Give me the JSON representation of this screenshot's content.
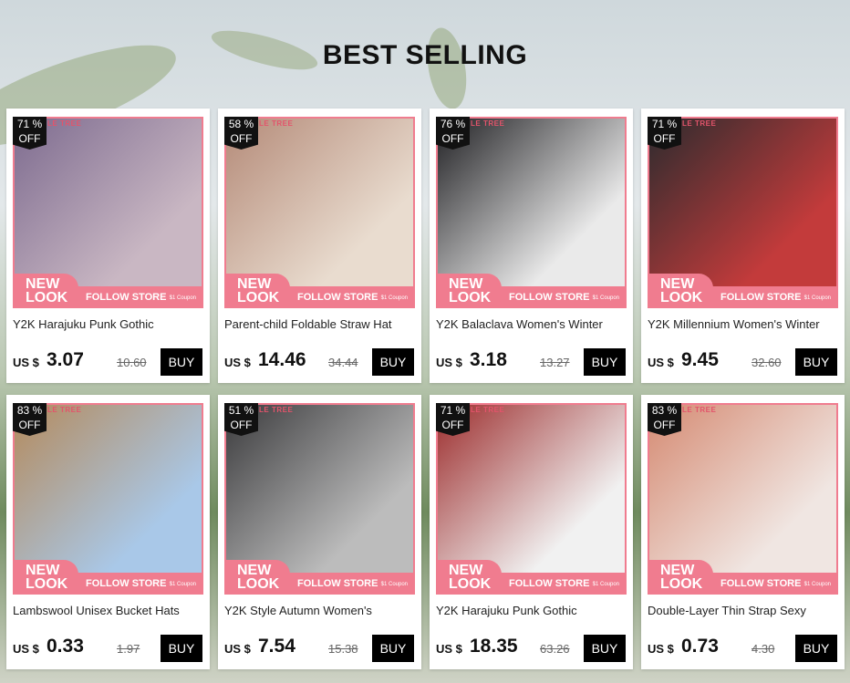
{
  "heading": "BEST SELLING",
  "store_tag": "LE TREE",
  "new_look": [
    "NEW",
    "LOOK"
  ],
  "follow_store": "FOLLOW STORE",
  "coupon": "$1 Coupon",
  "buy_label": "BUY",
  "off_label": "OFF",
  "currency": "US $",
  "colors": {
    "accent": "#f07c8f",
    "buy_bg": "#000000"
  },
  "products": [
    {
      "discount": "71 %",
      "title": "Y2K Harajuku Punk Gothic",
      "price": "3.07",
      "original": "10.60",
      "photo_colors": [
        "#7d6b8f",
        "#c9b7c3"
      ]
    },
    {
      "discount": "58 %",
      "title": "Parent-child Foldable Straw Hat",
      "price": "14.46",
      "original": "34.44",
      "photo_colors": [
        "#b48a78",
        "#e9dccf"
      ]
    },
    {
      "discount": "76 %",
      "title": "Y2K Balaclava Women's Winter",
      "price": "3.18",
      "original": "13.27",
      "photo_colors": [
        "#1f1f22",
        "#eaeaea"
      ]
    },
    {
      "discount": "71 %",
      "title": "Y2K Millennium Women's Winter",
      "price": "9.45",
      "original": "32.60",
      "photo_colors": [
        "#2b2b2e",
        "#c33b3b"
      ]
    },
    {
      "discount": "83 %",
      "title": "Lambswool Unisex Bucket Hats",
      "price": "0.33",
      "original": "1.97",
      "photo_colors": [
        "#b48a5c",
        "#a9c8e8"
      ]
    },
    {
      "discount": "51 %",
      "title": "Y2K Style Autumn Women's",
      "price": "7.54",
      "original": "15.38",
      "photo_colors": [
        "#3a3a3c",
        "#bcbcbc"
      ]
    },
    {
      "discount": "71 %",
      "title": "Y2K Harajuku Punk Gothic",
      "price": "18.35",
      "original": "63.26",
      "photo_colors": [
        "#9c2c2c",
        "#f1f1f1"
      ]
    },
    {
      "discount": "83 %",
      "title": "Double-Layer Thin Strap Sexy",
      "price": "0.73",
      "original": "4.30",
      "photo_colors": [
        "#d58a72",
        "#f0e6e2"
      ]
    }
  ]
}
